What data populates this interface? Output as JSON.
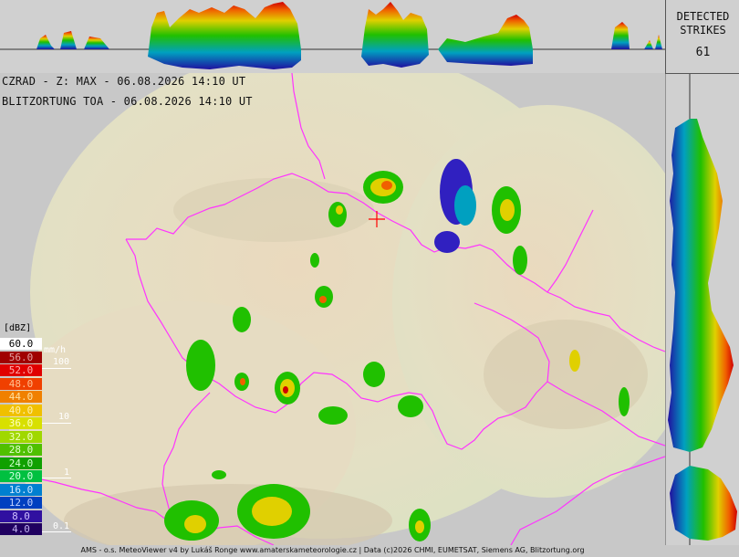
{
  "header": {
    "radar_line": "CZRAD - Z: MAX - 06.08.2026 14:10 UT",
    "lightning_line": "BLITZORTUNG TOA - 06.08.2026 14:10 UT"
  },
  "strikes": {
    "title_line1": "DETECTED",
    "title_line2": "STRIKES",
    "count": "61"
  },
  "legend": {
    "unit_label": "[dBZ]",
    "rows": [
      {
        "value": "60.0",
        "color": "#ffffff",
        "text_color": "#000000"
      },
      {
        "value": "56.0",
        "color": "#a00000",
        "text_color": "#e0a0a0"
      },
      {
        "value": "52.0",
        "color": "#e00000",
        "text_color": "#ffb0b0"
      },
      {
        "value": "48.0",
        "color": "#f04000",
        "text_color": "#ffc090"
      },
      {
        "value": "44.0",
        "color": "#f08000",
        "text_color": "#ffe0a0"
      },
      {
        "value": "40.0",
        "color": "#f0c000",
        "text_color": "#fff0b0"
      },
      {
        "value": "36.0",
        "color": "#d8e000",
        "text_color": "#ffffc0"
      },
      {
        "value": "32.0",
        "color": "#a0d800",
        "text_color": "#f0ffc0"
      },
      {
        "value": "28.0",
        "color": "#50c000",
        "text_color": "#e0ffd0"
      },
      {
        "value": "24.0",
        "color": "#10a000",
        "text_color": "#d0ffd0"
      },
      {
        "value": "20.0",
        "color": "#00c040",
        "text_color": "#d0ffe0"
      },
      {
        "value": "16.0",
        "color": "#0080d0",
        "text_color": "#d0e8ff"
      },
      {
        "value": "12.0",
        "color": "#0040c0",
        "text_color": "#c0d0ff"
      },
      {
        "value": "8.0",
        "color": "#3010a0",
        "text_color": "#d0c0ff"
      },
      {
        "value": "4.0",
        "color": "#200060",
        "text_color": "#c0b0f0"
      }
    ],
    "rain_unit": "mm/h",
    "rain_marks": [
      "100",
      "10",
      "1",
      "0.1"
    ]
  },
  "colors": {
    "border": "#ff33ff",
    "background": "#c8c8c8",
    "lightning_marker": "#ff0000"
  },
  "footer": {
    "credit": "AMS - o.s. MeteoViewer v4 by Lukáš Ronge www.amaterskameteorologie.cz | Data (c)2026 CHMI, EUMETSAT, Siemens AG, Blitzortung.org"
  }
}
